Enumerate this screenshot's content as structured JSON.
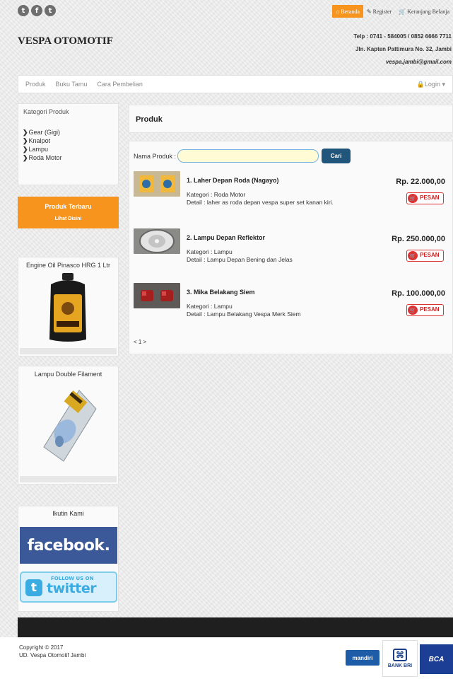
{
  "social": [
    "twitter-icon",
    "facebook-icon",
    "tumblr-icon"
  ],
  "topnav": {
    "beranda": "Beranda",
    "register": "Register",
    "keranjang": "Keranjang Belanja"
  },
  "header": {
    "brand": "VESPA OTOMOTIF",
    "phone": "Telp : 0741 - 584005 / 0852 6666 7711",
    "address": "Jln. Kapten Pattimura No. 32, Jambi",
    "email": "vespa.jambi@gmail.com"
  },
  "nav": {
    "items": [
      "Produk",
      "Buku Tamu",
      "Cara Pembelian"
    ],
    "login": "Login"
  },
  "sidebar": {
    "kategori_title": "Kategori Produk",
    "kategori": [
      "Gear (Gigi)",
      "Knalpot",
      "Lampu",
      "Roda Motor"
    ],
    "terbaru_title": "Produk Terbaru",
    "terbaru_link": "Lihat Disini",
    "featured": [
      {
        "title": "Engine Oil Pinasco HRG 1 Ltr"
      },
      {
        "title": "Lampu Double Filament"
      }
    ],
    "follow_title": "Ikutin Kami",
    "facebook": "facebook.",
    "twitter_follow": "FOLLOW US ON",
    "twitter": "twitter",
    "twitter_mark": "t"
  },
  "main": {
    "title": "Produk",
    "search_label": "Nama Produk :",
    "search_value": "",
    "search_button": "Cari",
    "order_button": "PESAN",
    "products": [
      {
        "name": "1. Laher Depan Roda (Nagayo)",
        "kategori": "Kategori : Roda Motor",
        "detail": "Detail : laher as roda depan vespa super set kanan kiri.",
        "price": "Rp. 22.000,00"
      },
      {
        "name": "2. Lampu Depan Reflektor",
        "kategori": "Kategori : Lampu",
        "detail": "Detail : Lampu Depan Bening dan Jelas",
        "price": "Rp. 250.000,00"
      },
      {
        "name": "3. Mika Belakang Siem",
        "kategori": "Kategori : Lampu",
        "detail": "Detail : Lampu Belakang Vespa Merk Siem",
        "price": "Rp. 100.000,00"
      }
    ],
    "pager": "< 1 >"
  },
  "footer": {
    "copyright": "Copyright © 2017",
    "company": "UD. Vespa Otomotif Jambi",
    "banks": [
      "mandiri",
      "BANK BRI",
      "BCA"
    ]
  }
}
